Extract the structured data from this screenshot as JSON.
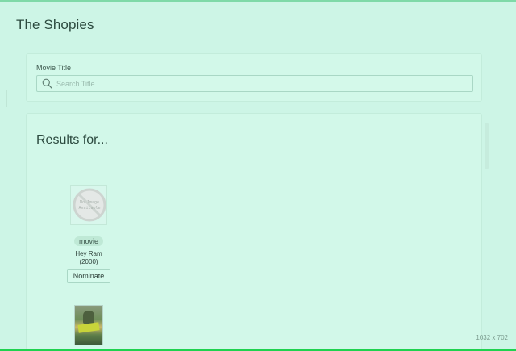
{
  "app": {
    "title": "The Shopies"
  },
  "search": {
    "label": "Movie Title",
    "placeholder": "Search Title...",
    "value": ""
  },
  "results": {
    "heading": "Results for...",
    "items": [
      {
        "poster": "no-image-placeholder",
        "poster_text": "No Image Available",
        "type": "movie",
        "title": "Hey Ram",
        "year": "(2000)",
        "action_label": "Nominate"
      },
      {
        "poster": "movie-poster-image"
      }
    ]
  },
  "overlay": {
    "size_readout": "1032 x 702"
  },
  "icons": {
    "search": "search-icon",
    "zoom": "zoom-in-icon"
  },
  "colors": {
    "background": "#cdf5e6",
    "card": "#d2f8e9",
    "accent_bottom_border": "#1fd24f"
  }
}
